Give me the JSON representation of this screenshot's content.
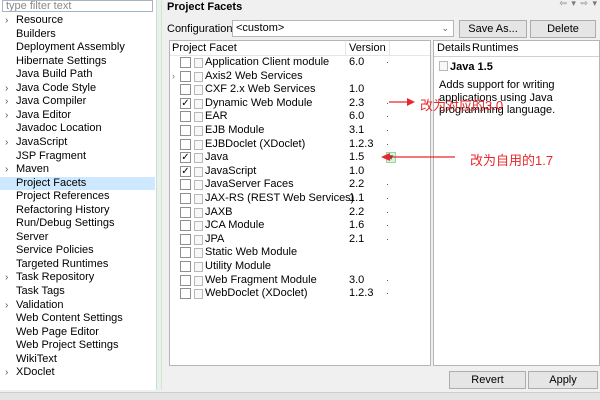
{
  "filter": {
    "placeholder": "type filter text"
  },
  "tree": [
    {
      "label": "Resource",
      "expandable": true
    },
    {
      "label": "Builders",
      "expandable": false
    },
    {
      "label": "Deployment Assembly",
      "expandable": false
    },
    {
      "label": "Hibernate Settings",
      "expandable": false
    },
    {
      "label": "Java Build Path",
      "expandable": false
    },
    {
      "label": "Java Code Style",
      "expandable": true
    },
    {
      "label": "Java Compiler",
      "expandable": true
    },
    {
      "label": "Java Editor",
      "expandable": true
    },
    {
      "label": "Javadoc Location",
      "expandable": false
    },
    {
      "label": "JavaScript",
      "expandable": true
    },
    {
      "label": "JSP Fragment",
      "expandable": false
    },
    {
      "label": "Maven",
      "expandable": true
    },
    {
      "label": "Project Facets",
      "expandable": false,
      "selected": true
    },
    {
      "label": "Project References",
      "expandable": false
    },
    {
      "label": "Refactoring History",
      "expandable": false
    },
    {
      "label": "Run/Debug Settings",
      "expandable": false
    },
    {
      "label": "Server",
      "expandable": false
    },
    {
      "label": "Service Policies",
      "expandable": false
    },
    {
      "label": "Targeted Runtimes",
      "expandable": false
    },
    {
      "label": "Task Repository",
      "expandable": true
    },
    {
      "label": "Task Tags",
      "expandable": false
    },
    {
      "label": "Validation",
      "expandable": true
    },
    {
      "label": "Web Content Settings",
      "expandable": false
    },
    {
      "label": "Web Page Editor",
      "expandable": false
    },
    {
      "label": "Web Project Settings",
      "expandable": false
    },
    {
      "label": "WikiText",
      "expandable": false
    },
    {
      "label": "XDoclet",
      "expandable": true
    }
  ],
  "page": {
    "title": "Project Facets",
    "nav": "⇦ ▾ ⇨ ▾",
    "config_label": "Configuration:",
    "config_value": "<custom>",
    "save_as": "Save As...",
    "delete": "Delete",
    "revert": "Revert",
    "apply": "Apply"
  },
  "facets": {
    "col_facet": "Project Facet",
    "col_version": "Version",
    "rows": [
      {
        "name": "Application Client module",
        "version": "6.0",
        "checked": false,
        "expand": false,
        "dd": true
      },
      {
        "name": "Axis2 Web Services",
        "version": "",
        "checked": false,
        "expand": true,
        "dd": false
      },
      {
        "name": "CXF 2.x Web Services",
        "version": "1.0",
        "checked": false,
        "expand": false,
        "dd": false
      },
      {
        "name": "Dynamic Web Module",
        "version": "2.3",
        "checked": true,
        "expand": false,
        "dd": true
      },
      {
        "name": "EAR",
        "version": "6.0",
        "checked": false,
        "expand": false,
        "dd": true
      },
      {
        "name": "EJB Module",
        "version": "3.1",
        "checked": false,
        "expand": false,
        "dd": true
      },
      {
        "name": "EJBDoclet (XDoclet)",
        "version": "1.2.3",
        "checked": false,
        "expand": false,
        "dd": true
      },
      {
        "name": "Java",
        "version": "1.5",
        "checked": true,
        "expand": false,
        "dd": true,
        "highlight": true
      },
      {
        "name": "JavaScript",
        "version": "1.0",
        "checked": true,
        "expand": false,
        "dd": false
      },
      {
        "name": "JavaServer Faces",
        "version": "2.2",
        "checked": false,
        "expand": false,
        "dd": true
      },
      {
        "name": "JAX-RS (REST Web Services)",
        "version": "1.1",
        "checked": false,
        "expand": false,
        "dd": true
      },
      {
        "name": "JAXB",
        "version": "2.2",
        "checked": false,
        "expand": false,
        "dd": true
      },
      {
        "name": "JCA Module",
        "version": "1.6",
        "checked": false,
        "expand": false,
        "dd": true
      },
      {
        "name": "JPA",
        "version": "2.1",
        "checked": false,
        "expand": false,
        "dd": true
      },
      {
        "name": "Static Web Module",
        "version": "",
        "checked": false,
        "expand": false,
        "dd": false
      },
      {
        "name": "Utility Module",
        "version": "",
        "checked": false,
        "expand": false,
        "dd": false
      },
      {
        "name": "Web Fragment Module",
        "version": "3.0",
        "checked": false,
        "expand": false,
        "dd": true
      },
      {
        "name": "WebDoclet (XDoclet)",
        "version": "1.2.3",
        "checked": false,
        "expand": false,
        "dd": true
      }
    ]
  },
  "details": {
    "tab_details": "Details",
    "tab_runtimes": "Runtimes",
    "title": "Java 1.5",
    "body": "Adds support for writing applications using Java programming language."
  },
  "annotations": {
    "web_module": "改为对应的3.0",
    "java": "改为自用的1.7",
    "color": "#e8282e"
  }
}
